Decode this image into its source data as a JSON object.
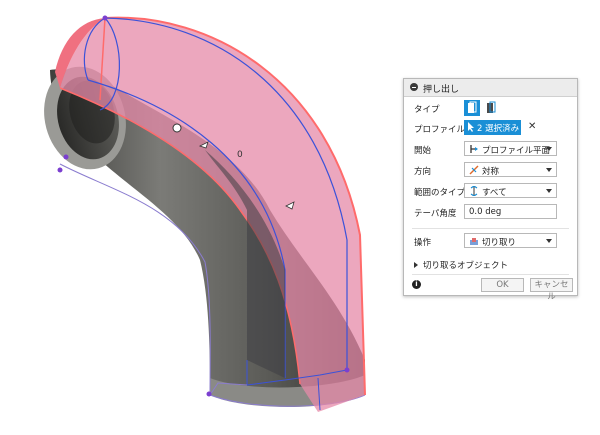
{
  "dialog": {
    "title": "押し出し",
    "rows": {
      "type": {
        "label": "タイプ"
      },
      "profile": {
        "label": "プロファイル",
        "value": "2 選択済み"
      },
      "start": {
        "label": "開始",
        "value": "プロファイル平面"
      },
      "direction": {
        "label": "方向",
        "value": "対称"
      },
      "extent": {
        "label": "範囲のタイプ",
        "value": "すべて"
      },
      "taper": {
        "label": "テーパ角度",
        "value": "0.0 deg"
      },
      "operation": {
        "label": "操作",
        "value": "切り取り"
      }
    },
    "objects_to_cut": "切り取るオブジェクト",
    "ok": "OK",
    "cancel": "キャンセル",
    "clear_symbol": "✕",
    "info_symbol": "i"
  },
  "viewport": {
    "angle_text": "0",
    "colors": {
      "body": "#6a6a66",
      "cut_fill": "#e58aa8",
      "cut_edge": "#ff6b6b",
      "sketch": "#3b52d9",
      "vertex": "#7b3fd0"
    }
  }
}
